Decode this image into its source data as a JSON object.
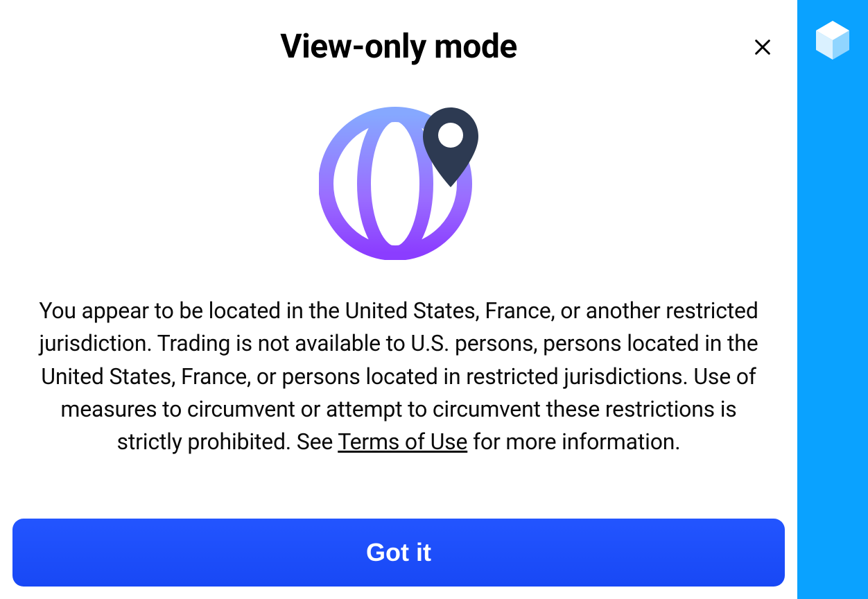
{
  "modal": {
    "title": "View-only mode",
    "body_before_link": "You appear to be located in the United States, France, or another restricted jurisdiction. Trading is not available to U.S. persons, persons located in the United States, France, or persons located in restricted jurisdictions. Use of measures to circumvent or attempt to circumvent these restrictions is strictly prohibited. See ",
    "link_text": "Terms of Use",
    "body_after_link": " for more information.",
    "button_label": "Got it",
    "icon": "globe-location-icon",
    "close_icon": "close-icon"
  },
  "sidebar": {
    "logo_icon": "brand-cube-icon"
  },
  "colors": {
    "accent_blue": "#1a4fff",
    "sidebar_blue": "#0aa2ff",
    "globe_gradient_top": "#86a8ff",
    "globe_gradient_bottom": "#8b3dff",
    "pin_dark": "#2d3a52"
  }
}
